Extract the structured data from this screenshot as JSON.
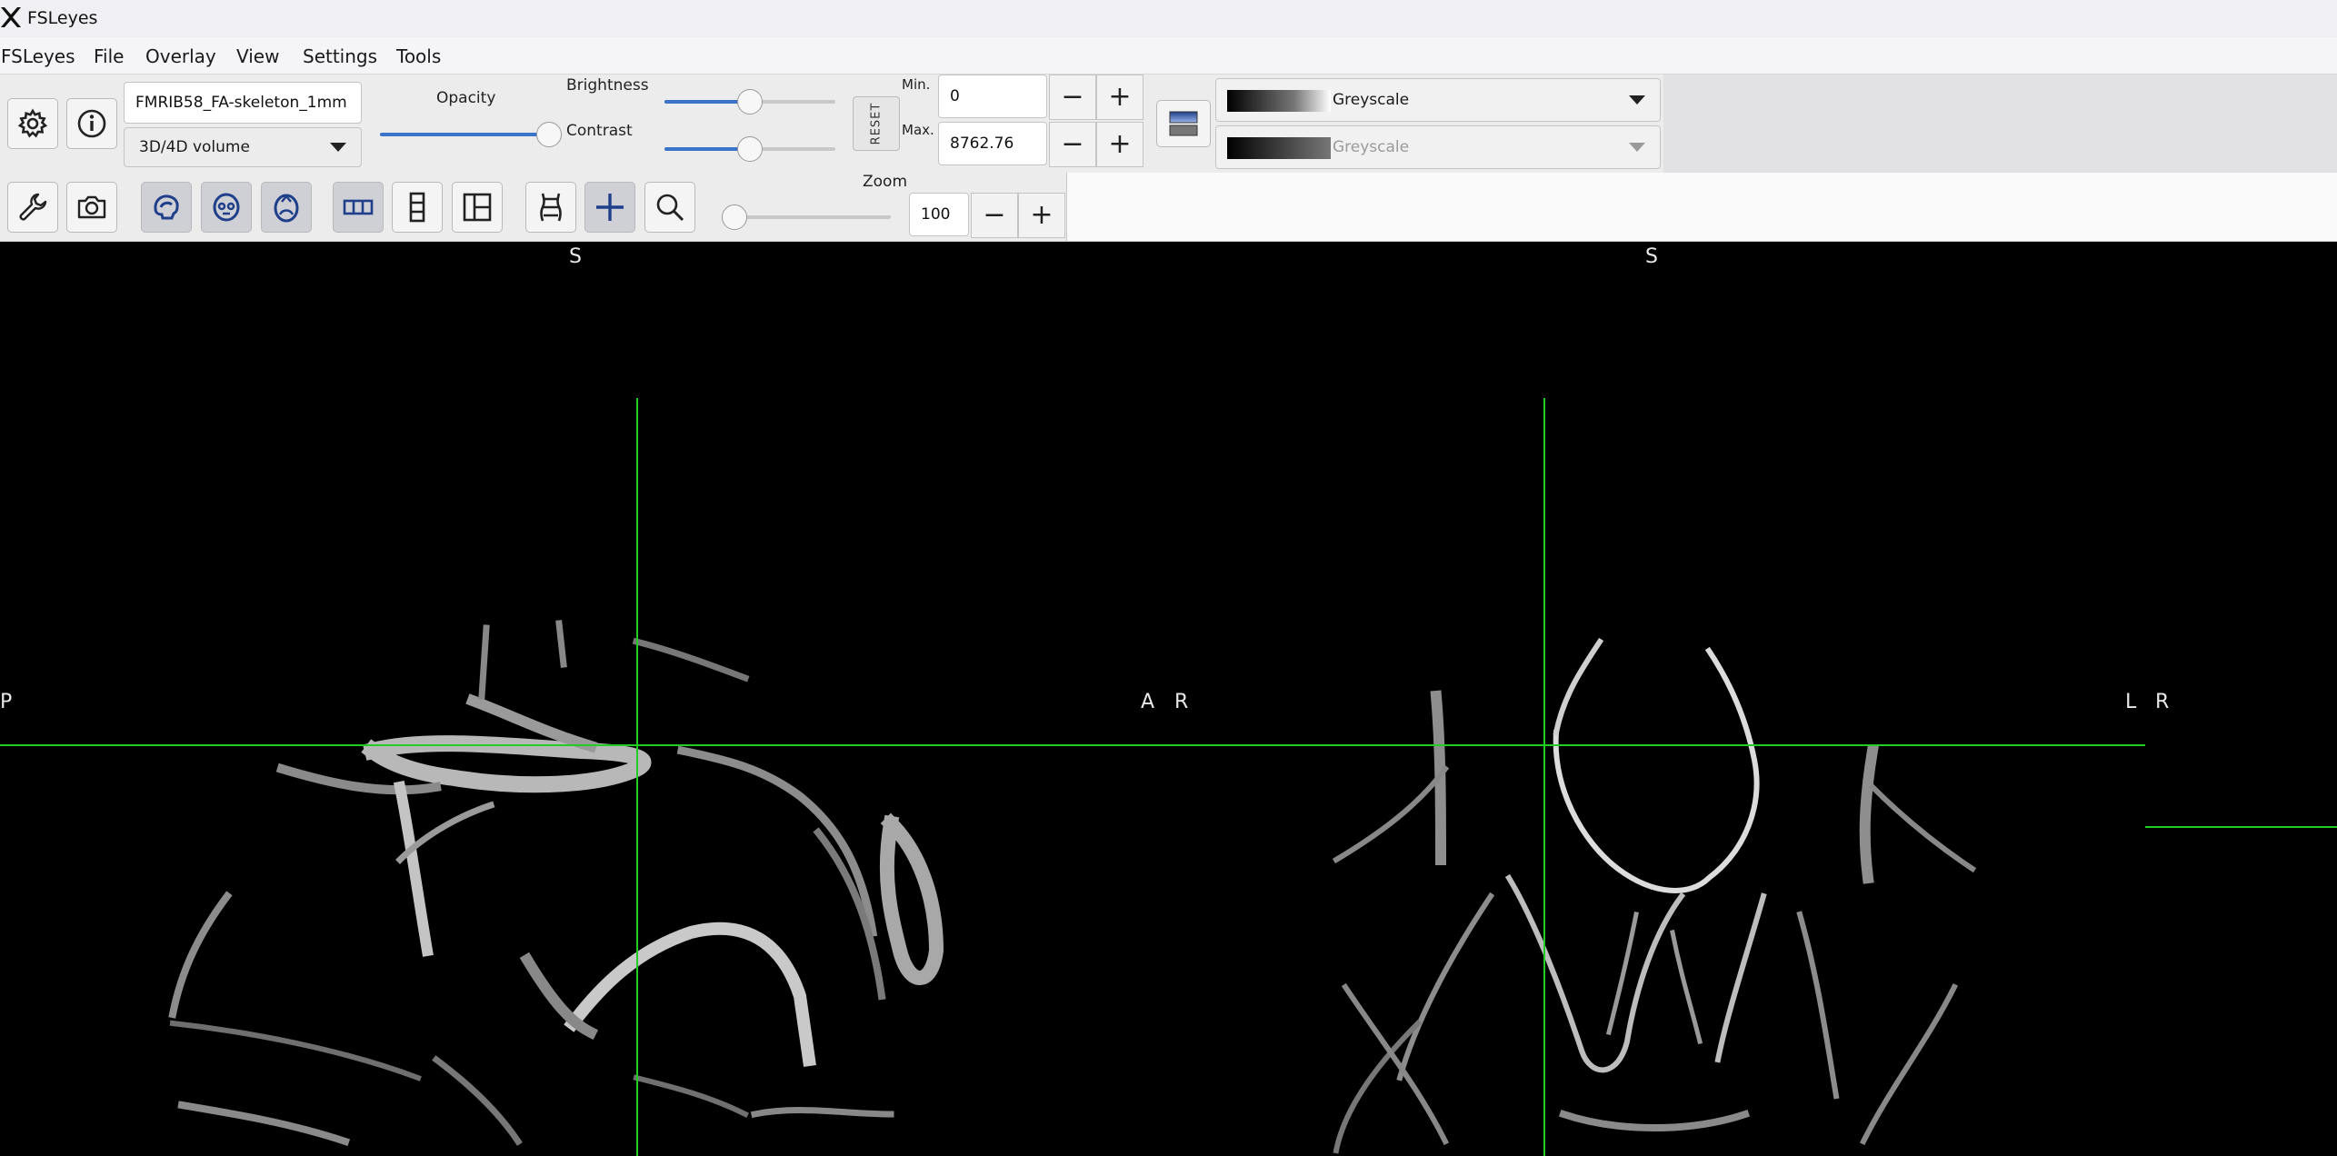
{
  "window": {
    "title": "FSLeyes"
  },
  "menu": {
    "items": [
      "FSLeyes",
      "File",
      "Overlay",
      "View",
      "Settings",
      "Tools"
    ]
  },
  "overlay_toolbar": {
    "overlay_name": "FMRIB58_FA-skeleton_1mm",
    "overlay_type": "3D/4D volume",
    "opacity_label": "Opacity",
    "opacity_value": 1.0,
    "brightness_label": "Brightness",
    "brightness_value": 0.5,
    "contrast_label": "Contrast",
    "contrast_value": 0.5,
    "reset_label": "RESET",
    "min_label": "Min.",
    "min_value": "0",
    "max_label": "Max.",
    "max_value": "8762.76",
    "colormap": "Greyscale",
    "neg_colormap": "Greyscale"
  },
  "ortho_toolbar": {
    "zoom_label": "Zoom",
    "zoom_value": "100",
    "zoom_fraction": 0.0
  },
  "viewer": {
    "sagittal": {
      "top": "S",
      "left": "P",
      "right": "A"
    },
    "coronal": {
      "top": "S",
      "left": "R",
      "right": "L"
    },
    "axial": {
      "left": "R"
    },
    "cursor_color": "#22cc22",
    "background": "#000000"
  },
  "colors": {
    "accent": "#3a73c8",
    "panel": "#ececec"
  }
}
